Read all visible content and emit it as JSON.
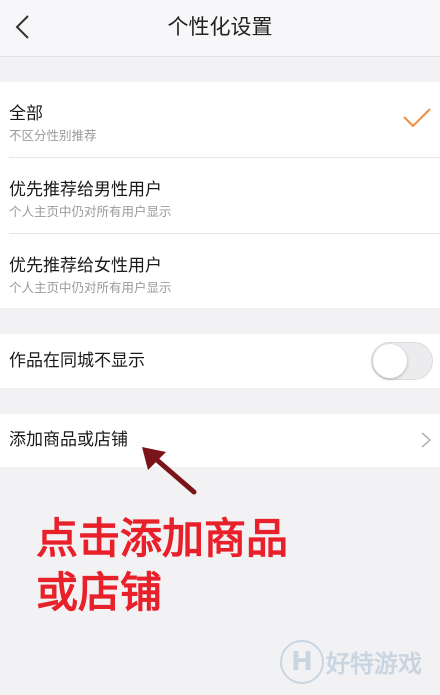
{
  "header": {
    "title": "个性化设置"
  },
  "gender_options": [
    {
      "title": "全部",
      "subtitle": "不区分性别推荐",
      "selected": true
    },
    {
      "title": "优先推荐给男性用户",
      "subtitle": "个人主页中仍对所有用户显示",
      "selected": false
    },
    {
      "title": "优先推荐给女性用户",
      "subtitle": "个人主页中仍对所有用户显示",
      "selected": false
    }
  ],
  "city_setting": {
    "label": "作品在同城不显示",
    "enabled": false
  },
  "shop_setting": {
    "label": "添加商品或店铺"
  },
  "annotation": {
    "line1": "点击添加商品",
    "line2": "或店铺"
  },
  "watermark": {
    "icon_letter": "H",
    "text": "好特游戏"
  },
  "colors": {
    "accent": "#f28c3c",
    "annotation": "#e8202a",
    "arrow": "#7a1418"
  }
}
